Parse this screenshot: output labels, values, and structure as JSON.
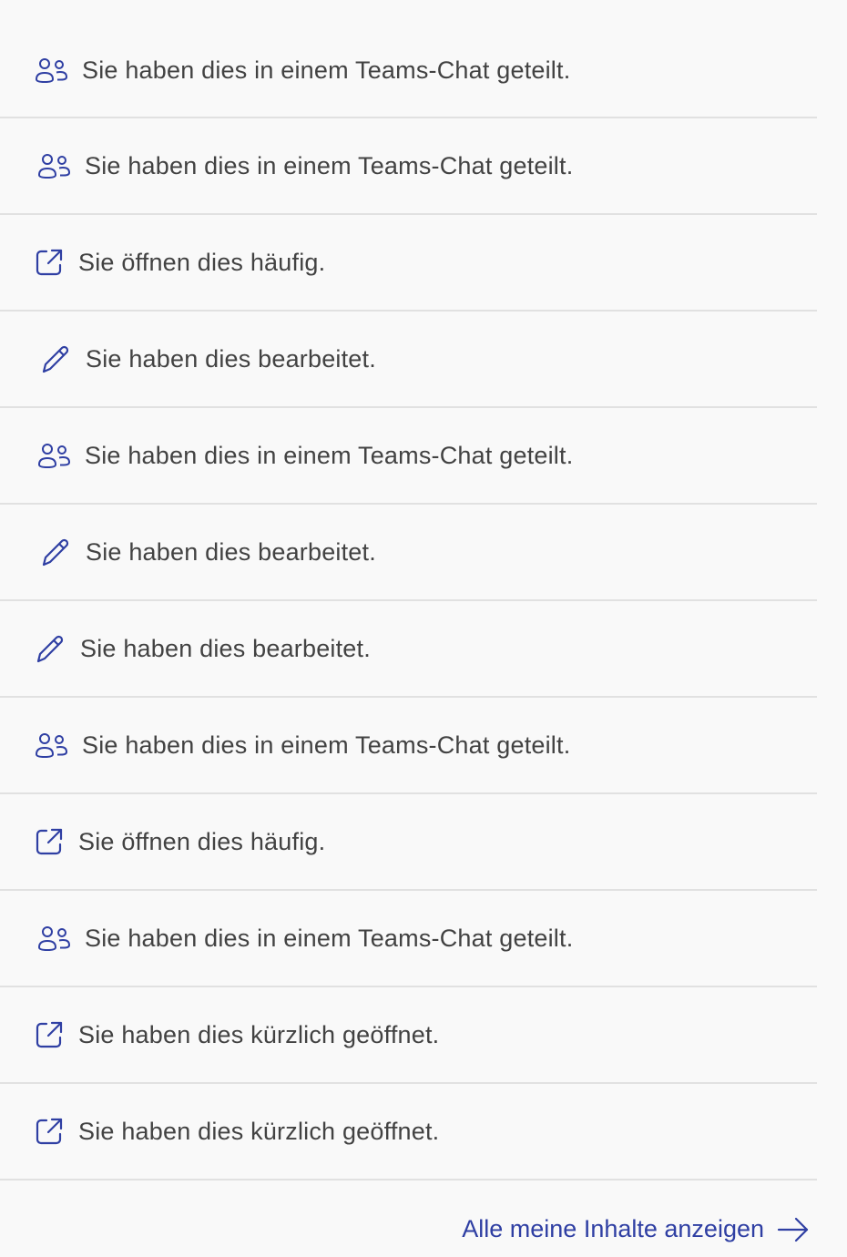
{
  "accent_color": "#2f3fa3",
  "text_color": "#424242",
  "activities": [
    {
      "icon": "people-icon",
      "text": "Sie haben dies in einem Teams-Chat geteilt.",
      "indent": 38
    },
    {
      "icon": "people-icon",
      "text": "Sie haben dies in einem Teams-Chat geteilt.",
      "indent": 41
    },
    {
      "icon": "open-external-icon",
      "text": "Sie öffnen dies häufig.",
      "indent": 38
    },
    {
      "icon": "pencil-icon",
      "text": "Sie haben dies bearbeitet.",
      "indent": 44
    },
    {
      "icon": "people-icon",
      "text": "Sie haben dies in einem Teams-Chat geteilt.",
      "indent": 41
    },
    {
      "icon": "pencil-icon",
      "text": "Sie haben dies bearbeitet.",
      "indent": 44
    },
    {
      "icon": "pencil-icon",
      "text": "Sie haben dies bearbeitet.",
      "indent": 38
    },
    {
      "icon": "people-icon",
      "text": "Sie haben dies in einem Teams-Chat geteilt.",
      "indent": 38
    },
    {
      "icon": "open-external-icon",
      "text": "Sie öffnen dies häufig.",
      "indent": 38
    },
    {
      "icon": "people-icon",
      "text": "Sie haben dies in einem Teams-Chat geteilt.",
      "indent": 41
    },
    {
      "icon": "open-external-icon",
      "text": "Sie haben dies kürzlich geöffnet.",
      "indent": 38
    },
    {
      "icon": "open-external-icon",
      "text": "Sie haben dies kürzlich geöffnet.",
      "indent": 38
    }
  ],
  "footer": {
    "link_label": "Alle meine Inhalte anzeigen",
    "link_icon": "arrow-right-icon"
  }
}
